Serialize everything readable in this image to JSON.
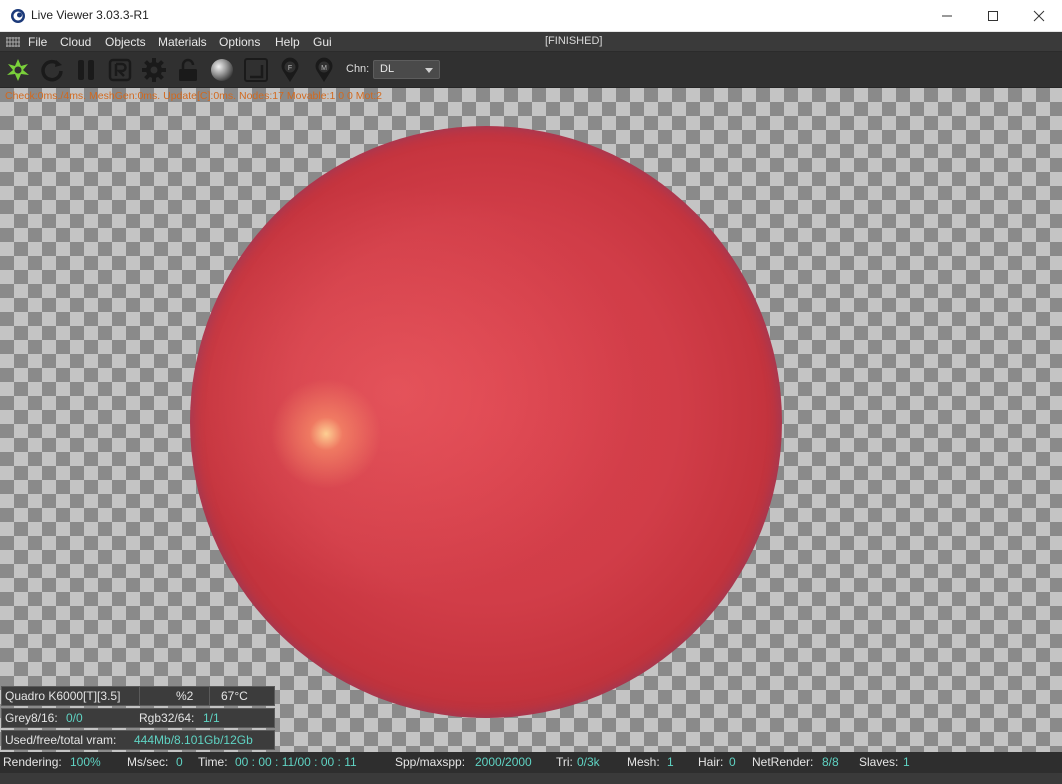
{
  "window": {
    "title": "Live Viewer 3.03.3-R1",
    "icon": "cinema4d-logo-icon",
    "controls": [
      "minimize-icon",
      "maximize-icon",
      "close-icon"
    ]
  },
  "menubar": {
    "items": [
      "File",
      "Cloud",
      "Objects",
      "Materials",
      "Options",
      "Help",
      "Gui"
    ],
    "status": "[FINISHED]"
  },
  "toolbar": {
    "tools": [
      "render-start-icon",
      "refresh-icon",
      "pause-icon",
      "region-render-icon",
      "settings-gear-icon",
      "lock-icon",
      "material-preview-icon",
      "clay-mode-icon",
      "focus-pick-icon",
      "material-pick-icon"
    ],
    "channel_label": "Chn:",
    "channel_value": "DL"
  },
  "viewport": {
    "stats_line": "Check:0ms./4ms. MeshGen:0ms. Update[C]:0ms. Nodes:17 Movable:1  0 0 Mot:2"
  },
  "info_panel": {
    "gpu": "Quadro K6000[T][3.5]",
    "gpu_percent": "%2",
    "gpu_temp": "67°C",
    "grey_label": "Grey8/16:",
    "grey_value": "0/0",
    "rgb_label": "Rgb32/64:",
    "rgb_value": "1/1",
    "vram_label": "Used/free/total vram:",
    "vram_value": "444Mb/8.101Gb/12Gb"
  },
  "statusbar": {
    "rendering_label": "Rendering:",
    "rendering_value": "100%",
    "ms_label": "Ms/sec:",
    "ms_value": "0",
    "time_label": "Time:",
    "time_value": "00 : 00 : 11/00 : 00 : 11",
    "spp_label": "Spp/maxspp:",
    "spp_value": "2000/2000",
    "tri_label": "Tri:",
    "tri_value": "0/3k",
    "mesh_label": "Mesh:",
    "mesh_value": "1",
    "hair_label": "Hair:",
    "hair_value": "0",
    "netrender_label": "NetRender:",
    "netrender_value": "8/8",
    "slaves_label": "Slaves:",
    "slaves_value": "1"
  },
  "colors": {
    "value_accent": "#5fd3c3",
    "stats_orange": "#d2691e",
    "render_icon_green": "#7ad13a"
  }
}
